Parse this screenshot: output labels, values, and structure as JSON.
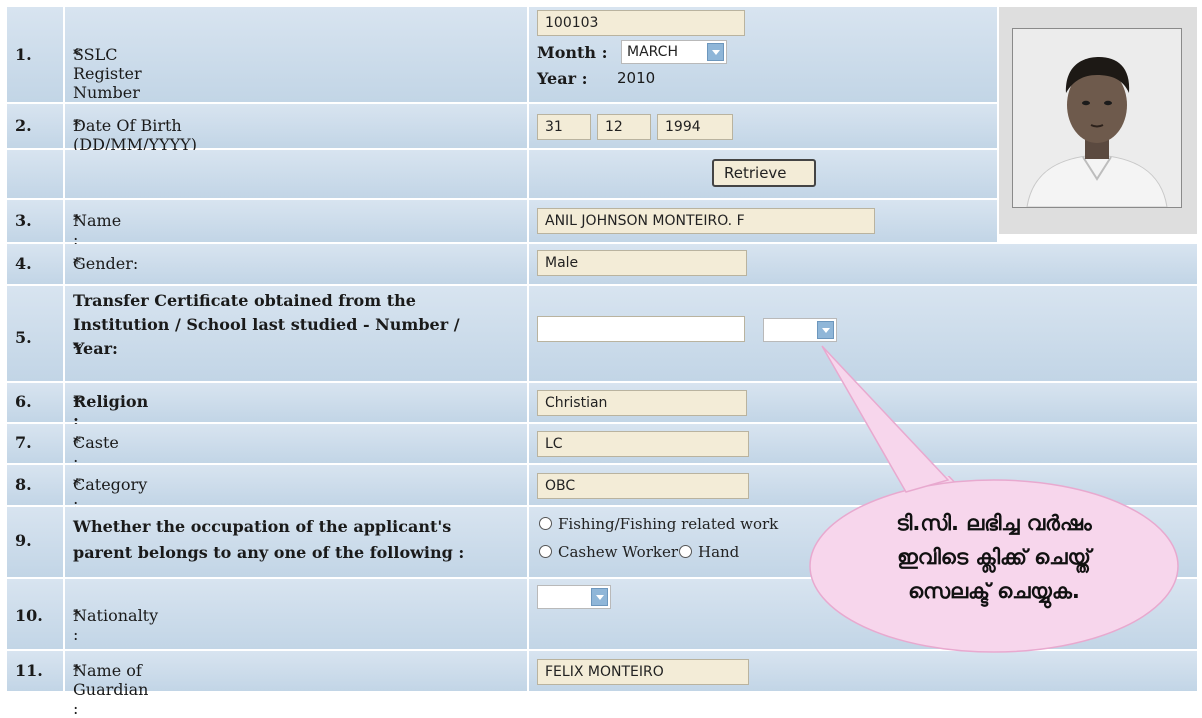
{
  "rows": [
    {
      "num": "1.",
      "label": "SSLC Register Number :",
      "star": "*"
    },
    {
      "num": "2.",
      "label": "Date Of Birth (DD/MM/YYYY) :",
      "star": "*"
    },
    {
      "num": "",
      "label": "",
      "star": ""
    },
    {
      "num": "3.",
      "label": "Name :",
      "star": "*"
    },
    {
      "num": "4.",
      "label": "Gender:",
      "star": "*"
    },
    {
      "num": "5.",
      "label_lines": [
        "Transfer Certificate obtained from the",
        "Institution / School last studied - Number /",
        "Year:"
      ],
      "star": "*"
    },
    {
      "num": "6.",
      "label": "Religion :",
      "star": "*"
    },
    {
      "num": "7.",
      "label": "Caste :",
      "star": "*"
    },
    {
      "num": "8.",
      "label": "Category :",
      "star": "*"
    },
    {
      "num": "9.",
      "label_lines": [
        "Whether the occupation of the applicant's",
        "parent belongs to any one of the following :"
      ]
    },
    {
      "num": "10.",
      "label": "Nationalty :",
      "star": "*"
    },
    {
      "num": "11.",
      "label": "Name of Guardian :",
      "star": "*"
    }
  ],
  "fields": {
    "sslc_register_number": "100103",
    "month_label": "Month :",
    "month_value": "MARCH",
    "year_label": "Year :",
    "year_value": "2010",
    "dob_day": "31",
    "dob_month": "12",
    "dob_year": "1994",
    "retrieve_label": "Retrieve",
    "name": "ANIL JOHNSON MONTEIRO. F",
    "gender": "Male",
    "tc_number": "",
    "tc_year": "",
    "religion": "Christian",
    "caste": "LC",
    "category": "OBC",
    "occupation_options": [
      "Fishing/Fishing related work",
      "Cashew Worker",
      "Hand"
    ],
    "nationality": "",
    "guardian": "FELIX MONTEIRO"
  },
  "callout": {
    "lines": [
      "ടി.സി. ലഭിച്ച വർഷം",
      "ഇവിടെ ക്ലിക്ക് ചെയ്ത്",
      "സെലക്ട് ചെയ്യുക."
    ]
  },
  "icons": {
    "photo": "applicant-photo",
    "dropdown": "chevron-down-icon"
  }
}
